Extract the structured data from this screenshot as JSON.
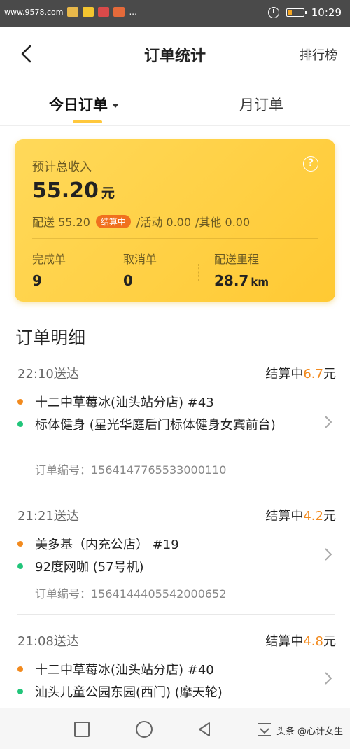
{
  "status_bar": {
    "url": "www.9578.com",
    "time": "10:29",
    "dots": "..."
  },
  "nav": {
    "title": "订单统计",
    "right_label": "排行榜"
  },
  "tabs": {
    "today": "今日订单",
    "monthly": "月订单"
  },
  "earnings": {
    "label": "预计总收入",
    "total": "55.20",
    "unit": "元",
    "delivery_label": "配送 55.20",
    "badge": "结算中",
    "activity": "/活动 0.00",
    "other": "/其他 0.00",
    "stats": [
      {
        "label": "完成单",
        "value": "9",
        "unit": ""
      },
      {
        "label": "取消单",
        "value": "0",
        "unit": ""
      },
      {
        "label": "配送里程",
        "value": "28.7",
        "unit": "km"
      }
    ],
    "help_glyph": "?"
  },
  "section_title": "订单明细",
  "orders": [
    {
      "time": "22:10送达",
      "status": "结算中",
      "amount": "6.7",
      "amount_unit": "元",
      "pickup": "十二中草莓冰(汕头站分店) #43",
      "dropoff": "标体健身 (星光华庭后门标体健身女宾前台)",
      "order_no": "订单编号：1564147765533000110"
    },
    {
      "time": "21:21送达",
      "status": "结算中",
      "amount": "4.2",
      "amount_unit": "元",
      "pickup": "美多基（内充公店） #19",
      "dropoff": "92度网咖 (57号机)",
      "order_no": "订单编号：1564144405542000652"
    },
    {
      "time": "21:08送达",
      "status": "结算中",
      "amount": "4.8",
      "amount_unit": "元",
      "pickup": "十二中草莓冰(汕头站分店) #40",
      "dropoff": "汕头儿童公园东园(西门) (摩天轮)",
      "order_no": ""
    }
  ],
  "watermark": "头条 @心计女生",
  "colors": {
    "accent_yellow": "#ffc83d",
    "amount_orange": "#f28a1e",
    "pickup_dot": "#f28a1e",
    "dropoff_dot": "#21c57a",
    "badge_orange": "#f0701e"
  }
}
